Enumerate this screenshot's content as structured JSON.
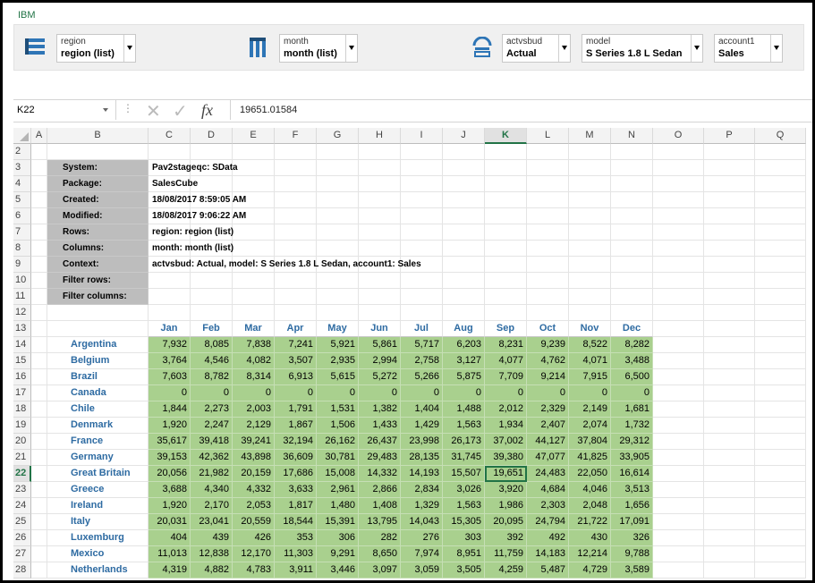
{
  "app": {
    "brand": "IBM"
  },
  "dimension_bar": {
    "items": [
      {
        "name": "region",
        "value": "region (list)",
        "icon": "rows-icon"
      },
      {
        "name": "month",
        "value": "month (list)",
        "icon": "columns-icon"
      },
      {
        "name": "actvsbud",
        "value": "Actual",
        "icon": "context-icon"
      },
      {
        "name": "model",
        "value": "S Series 1.8 L Sedan"
      },
      {
        "name": "account1",
        "value": "Sales"
      }
    ]
  },
  "formula_bar": {
    "name_box": "K22",
    "formula": "19651.01584",
    "fx": "fx"
  },
  "columns": [
    "A",
    "B",
    "C",
    "D",
    "E",
    "F",
    "G",
    "H",
    "I",
    "J",
    "K",
    "L",
    "M",
    "N",
    "O",
    "P",
    "Q"
  ],
  "selected_column": "K",
  "selected_row": "22",
  "rows": [
    "2",
    "3",
    "4",
    "5",
    "6",
    "7",
    "8",
    "9",
    "10",
    "11",
    "12",
    "13",
    "14",
    "15",
    "16",
    "17",
    "18",
    "19",
    "20",
    "21",
    "22",
    "23",
    "24",
    "25",
    "26",
    "27",
    "28"
  ],
  "info": [
    {
      "label": "System:",
      "value": "Pav2stageqc: SData"
    },
    {
      "label": "Package:",
      "value": "SalesCube"
    },
    {
      "label": "Created:",
      "value": "18/08/2017 8:59:05 AM"
    },
    {
      "label": "Modified:",
      "value": "18/08/2017 9:06:22 AM"
    },
    {
      "label": "Rows:",
      "value": "region: region (list)"
    },
    {
      "label": "Columns:",
      "value": "month: month (list)"
    },
    {
      "label": "Context:",
      "value": "actvsbud: Actual, model: S Series 1.8 L Sedan, account1: Sales"
    },
    {
      "label": "Filter rows:",
      "value": ""
    },
    {
      "label": "Filter columns:",
      "value": ""
    }
  ],
  "months": [
    "Jan",
    "Feb",
    "Mar",
    "Apr",
    "May",
    "Jun",
    "Jul",
    "Aug",
    "Sep",
    "Oct",
    "Nov",
    "Dec"
  ],
  "table": [
    {
      "region": "Argentina",
      "values": [
        "7,932",
        "8,085",
        "7,838",
        "7,241",
        "5,921",
        "5,861",
        "5,717",
        "6,203",
        "8,231",
        "9,239",
        "8,522",
        "8,282"
      ]
    },
    {
      "region": "Belgium",
      "values": [
        "3,764",
        "4,546",
        "4,082",
        "3,507",
        "2,935",
        "2,994",
        "2,758",
        "3,127",
        "4,077",
        "4,762",
        "4,071",
        "3,488"
      ]
    },
    {
      "region": "Brazil",
      "values": [
        "7,603",
        "8,782",
        "8,314",
        "6,913",
        "5,615",
        "5,272",
        "5,266",
        "5,875",
        "7,709",
        "9,214",
        "7,915",
        "6,500"
      ]
    },
    {
      "region": "Canada",
      "values": [
        "0",
        "0",
        "0",
        "0",
        "0",
        "0",
        "0",
        "0",
        "0",
        "0",
        "0",
        "0"
      ]
    },
    {
      "region": "Chile",
      "values": [
        "1,844",
        "2,273",
        "2,003",
        "1,791",
        "1,531",
        "1,382",
        "1,404",
        "1,488",
        "2,012",
        "2,329",
        "2,149",
        "1,681"
      ]
    },
    {
      "region": "Denmark",
      "values": [
        "1,920",
        "2,247",
        "2,129",
        "1,867",
        "1,506",
        "1,433",
        "1,429",
        "1,563",
        "1,934",
        "2,407",
        "2,074",
        "1,732"
      ]
    },
    {
      "region": "France",
      "values": [
        "35,617",
        "39,418",
        "39,241",
        "32,194",
        "26,162",
        "26,437",
        "23,998",
        "26,173",
        "37,002",
        "44,127",
        "37,804",
        "29,312"
      ]
    },
    {
      "region": "Germany",
      "values": [
        "39,153",
        "42,362",
        "43,898",
        "36,609",
        "30,781",
        "29,483",
        "28,135",
        "31,745",
        "39,380",
        "47,077",
        "41,825",
        "33,905"
      ]
    },
    {
      "region": "Great Britain",
      "values": [
        "20,056",
        "21,982",
        "20,159",
        "17,686",
        "15,008",
        "14,332",
        "14,193",
        "15,507",
        "19,651",
        "24,483",
        "22,050",
        "16,614"
      ]
    },
    {
      "region": "Greece",
      "values": [
        "3,688",
        "4,340",
        "4,332",
        "3,633",
        "2,961",
        "2,866",
        "2,834",
        "3,026",
        "3,920",
        "4,684",
        "4,046",
        "3,513"
      ]
    },
    {
      "region": "Ireland",
      "values": [
        "1,920",
        "2,170",
        "2,053",
        "1,817",
        "1,480",
        "1,408",
        "1,329",
        "1,563",
        "1,986",
        "2,303",
        "2,048",
        "1,656"
      ]
    },
    {
      "region": "Italy",
      "values": [
        "20,031",
        "23,041",
        "20,559",
        "18,544",
        "15,391",
        "13,795",
        "14,043",
        "15,305",
        "20,095",
        "24,794",
        "21,722",
        "17,091"
      ]
    },
    {
      "region": "Luxemburg",
      "values": [
        "404",
        "439",
        "426",
        "353",
        "306",
        "282",
        "276",
        "303",
        "392",
        "492",
        "430",
        "326"
      ]
    },
    {
      "region": "Mexico",
      "values": [
        "11,013",
        "12,838",
        "12,170",
        "11,303",
        "9,291",
        "8,650",
        "7,974",
        "8,951",
        "11,759",
        "14,183",
        "12,214",
        "9,788"
      ]
    },
    {
      "region": "Netherlands",
      "values": [
        "4,319",
        "4,882",
        "4,783",
        "3,911",
        "3,446",
        "3,097",
        "3,059",
        "3,505",
        "4,259",
        "5,487",
        "4,729",
        "3,589"
      ]
    }
  ]
}
